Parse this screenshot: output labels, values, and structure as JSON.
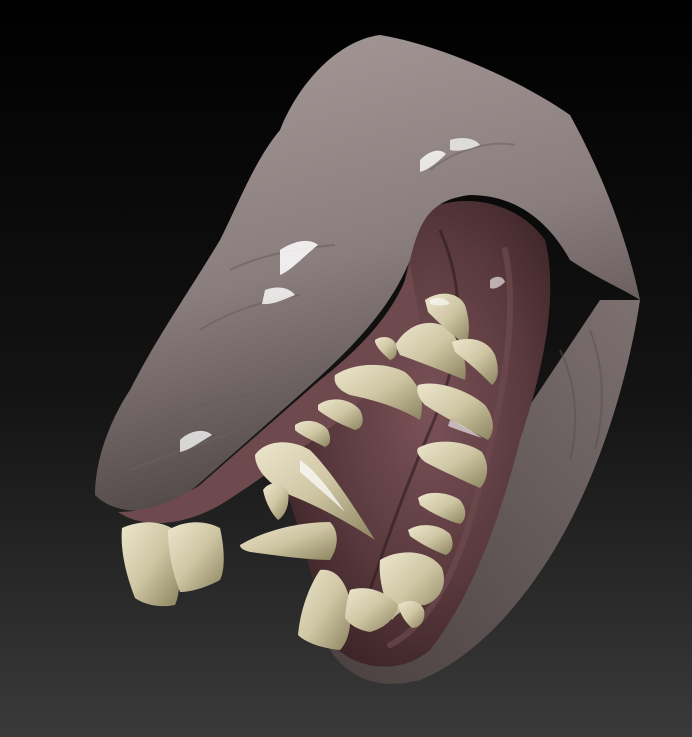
{
  "scene": {
    "subject": "sculpted-creature-head-render",
    "palette": {
      "background_top": "#000000",
      "background_bottom": "#3a3a3a",
      "skin": "#8a7d7d",
      "skin_light": "#a79b9a",
      "skin_shadow": "#4e4444",
      "gum": "#6e4a4e",
      "gum_dark": "#3e2528",
      "tooth": "#cfc6a4",
      "tooth_light": "#ece6cc",
      "tooth_shadow": "#8c845f",
      "specular": "#ffffff"
    }
  }
}
